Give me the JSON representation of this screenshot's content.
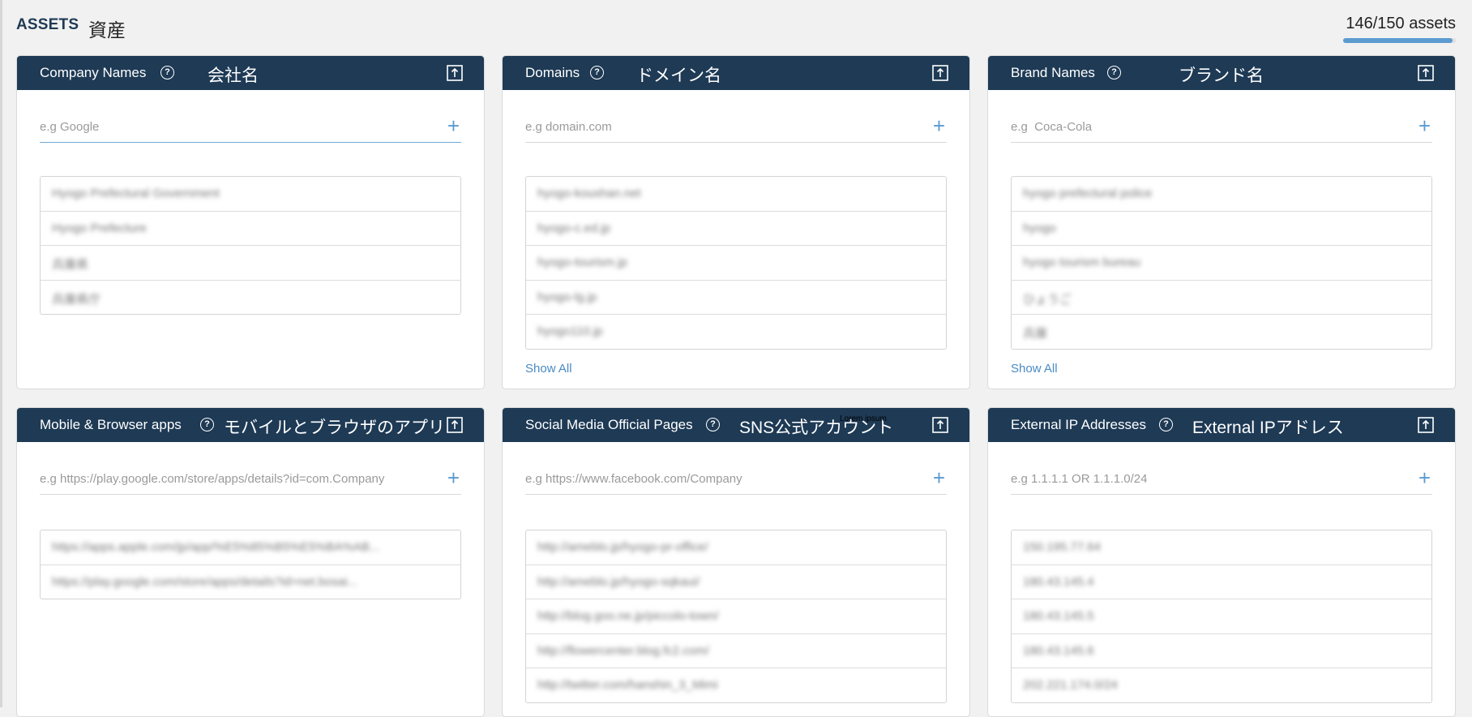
{
  "header": {
    "title": "ASSETS",
    "title_jp": "資産",
    "count": "146/150 assets",
    "progress_fraction": 0.973
  },
  "colors": {
    "header_bg": "#1e3a55",
    "accent": "#5b9bd0"
  },
  "cards": [
    {
      "title": "Company Names",
      "title_jp": "会社名",
      "placeholder": "e.g Google",
      "items": [
        "Hyogo Prefectural Government",
        "Hyogo Prefecture",
        "兵庫県",
        "兵庫県庁"
      ],
      "show_all": ""
    },
    {
      "title": "Domains",
      "title_jp": "ドメイン名",
      "placeholder": "e.g domain.com",
      "items": [
        "hyogo-koushan.net",
        "hyogo-c.ed.jp",
        "hyogo-tourism.jp",
        "hyogo-lg.jp",
        "hyogo110.jp"
      ],
      "show_all": "Show All"
    },
    {
      "title": "Brand Names",
      "title_jp": "ブランド名",
      "placeholder": "e.g  Coca-Cola",
      "items": [
        "hyogo prefectural police",
        "hyogo",
        "hyogo tourism bureau",
        "ひょうご",
        "兵庫"
      ],
      "show_all": "Show All"
    },
    {
      "title": "Mobile & Browser apps",
      "title_jp": "モバイルとブラウザのアプリ",
      "placeholder": "e.g https://play.google.com/store/apps/details?id=com.Company",
      "items": [
        "https://apps.apple.com/jp/app/%E5%85%B5%E5%BA%AB...",
        "https://play.google.com/store/apps/details?id=net.bosai..."
      ],
      "show_all": ""
    },
    {
      "title": "Social Media Official Pages",
      "title_jp": "SNS公式アカウント",
      "tag": "Lorem ipsum",
      "placeholder": "e.g https://www.facebook.com/Company",
      "items": [
        "http://ameblo.jp/hyogo-pr-office/",
        "http://ameblo.jp/hyogo-sqkaui/",
        "http://blog.goo.ne.jp/piccolo-town/",
        "http://flowercenter.blog.fc2.com/",
        "http://twitter.com/hanshin_3_Mimi"
      ],
      "show_all": ""
    },
    {
      "title": "External IP Addresses",
      "title_jp": "External IPアドレス",
      "placeholder": "e.g 1.1.1.1 OR 1.1.1.0/24",
      "items": [
        "150.195.77.64",
        "180.43.145.4",
        "180.43.145.5",
        "180.43.145.6",
        "202.221.174.0/24"
      ],
      "show_all": ""
    }
  ]
}
